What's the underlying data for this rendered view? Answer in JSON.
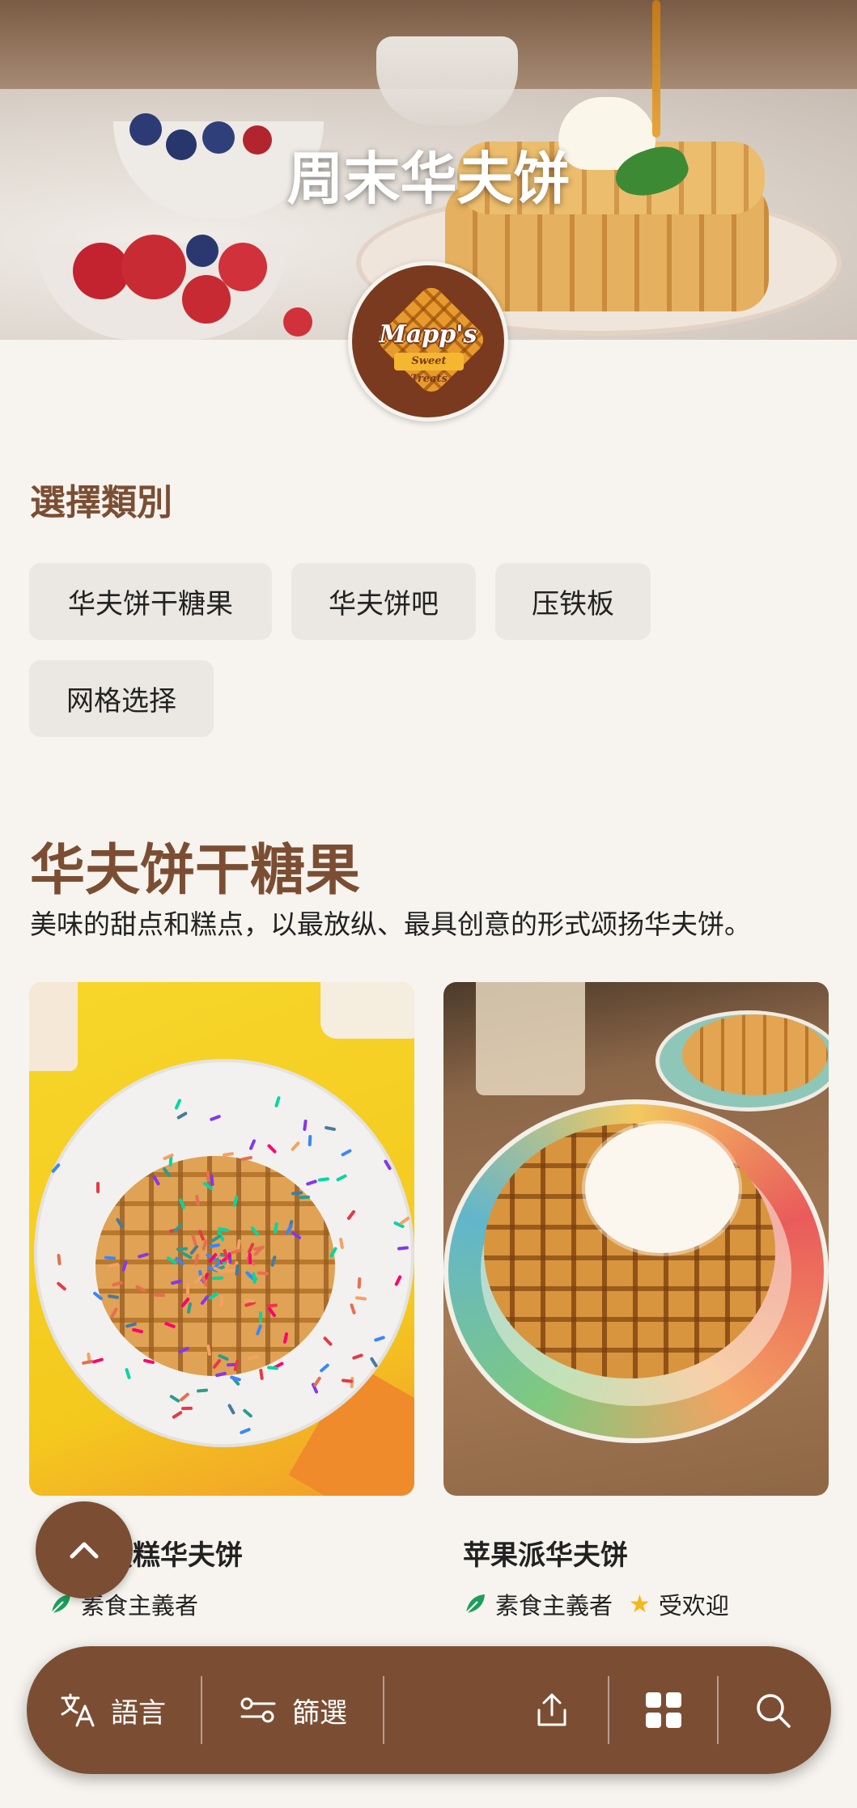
{
  "hero": {
    "title": "周末华夫饼"
  },
  "logo": {
    "brand": "Mapp's",
    "sub": "Sweet Treats"
  },
  "category": {
    "label": "選擇類別",
    "chips": [
      "华夫饼干糖果",
      "华夫饼吧",
      "压铁板",
      "网格选择"
    ]
  },
  "section": {
    "heading": "华夫饼干糖果",
    "description": "美味的甜点和糕点，以最放纵、最具创意的形式颂扬华夫饼。"
  },
  "cards": [
    {
      "title": "蛋糕华夫饼",
      "tags": [
        {
          "icon": "vegan-leaf-icon",
          "label": "素食主義者"
        }
      ]
    },
    {
      "title": "苹果派华夫饼",
      "tags": [
        {
          "icon": "vegan-leaf-icon",
          "label": "素食主義者"
        },
        {
          "icon": "star-icon",
          "label": "受欢迎"
        }
      ]
    }
  ],
  "bottom_bar": {
    "language_label": "語言",
    "filter_label": "篩選",
    "icons": [
      "translate-icon",
      "filter-icon",
      "share-icon",
      "grid-icon",
      "search-icon"
    ]
  },
  "colors": {
    "brand": "#7b4e33",
    "background": "#f7f4ef",
    "chip": "#ebe7e2",
    "leaf": "#1e9e5a",
    "star": "#f3b81c"
  }
}
